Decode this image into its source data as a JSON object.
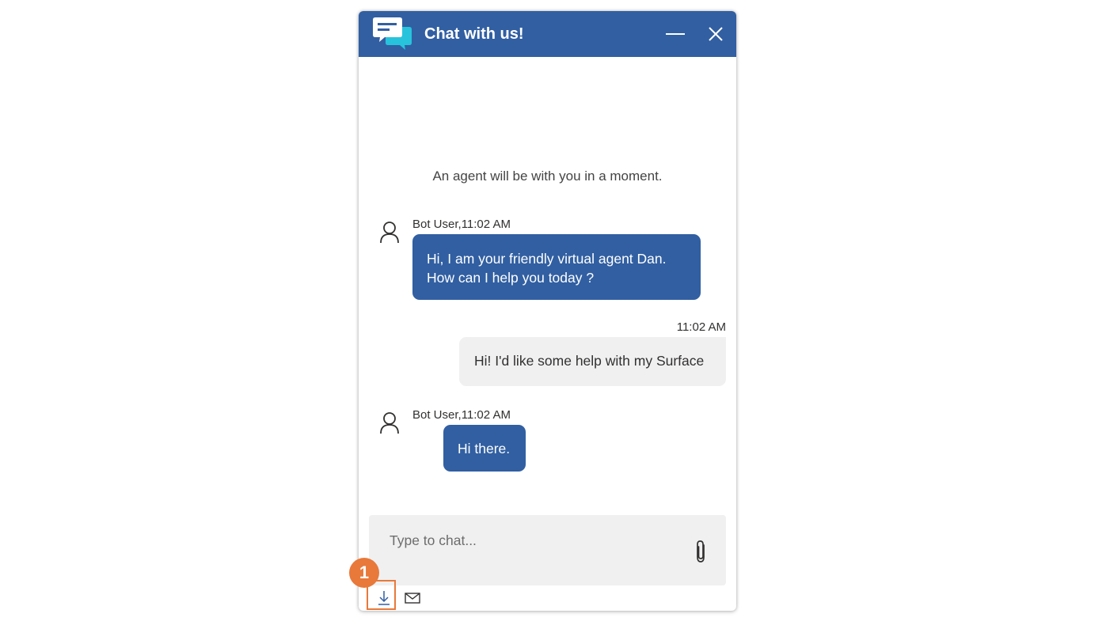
{
  "header": {
    "title": "Chat with us!",
    "icons": {
      "logo": "chat-bubbles-icon",
      "minimize": "minimize-icon",
      "close": "close-icon"
    }
  },
  "messages": {
    "system": "An agent will be with you in a moment.",
    "bot1": {
      "sender": "Bot User,11:02 AM",
      "line1": "Hi, I am your friendly virtual agent Dan.",
      "line2": "How can I help you today ?"
    },
    "user1": {
      "timestamp": "11:02 AM",
      "text": "Hi! I'd like some help with my Surface"
    },
    "bot2": {
      "sender": "Bot User,11:02 AM",
      "text": "Hi there."
    }
  },
  "input": {
    "placeholder": "Type to chat...",
    "value": ""
  },
  "toolbar": {
    "icons": [
      "download-transcript-icon",
      "email-transcript-icon"
    ]
  },
  "annotation": {
    "callout_number": "1"
  },
  "colors": {
    "brand": "#315fa2",
    "user_bubble": "#f0f0f1",
    "callout": "#e8793a"
  }
}
